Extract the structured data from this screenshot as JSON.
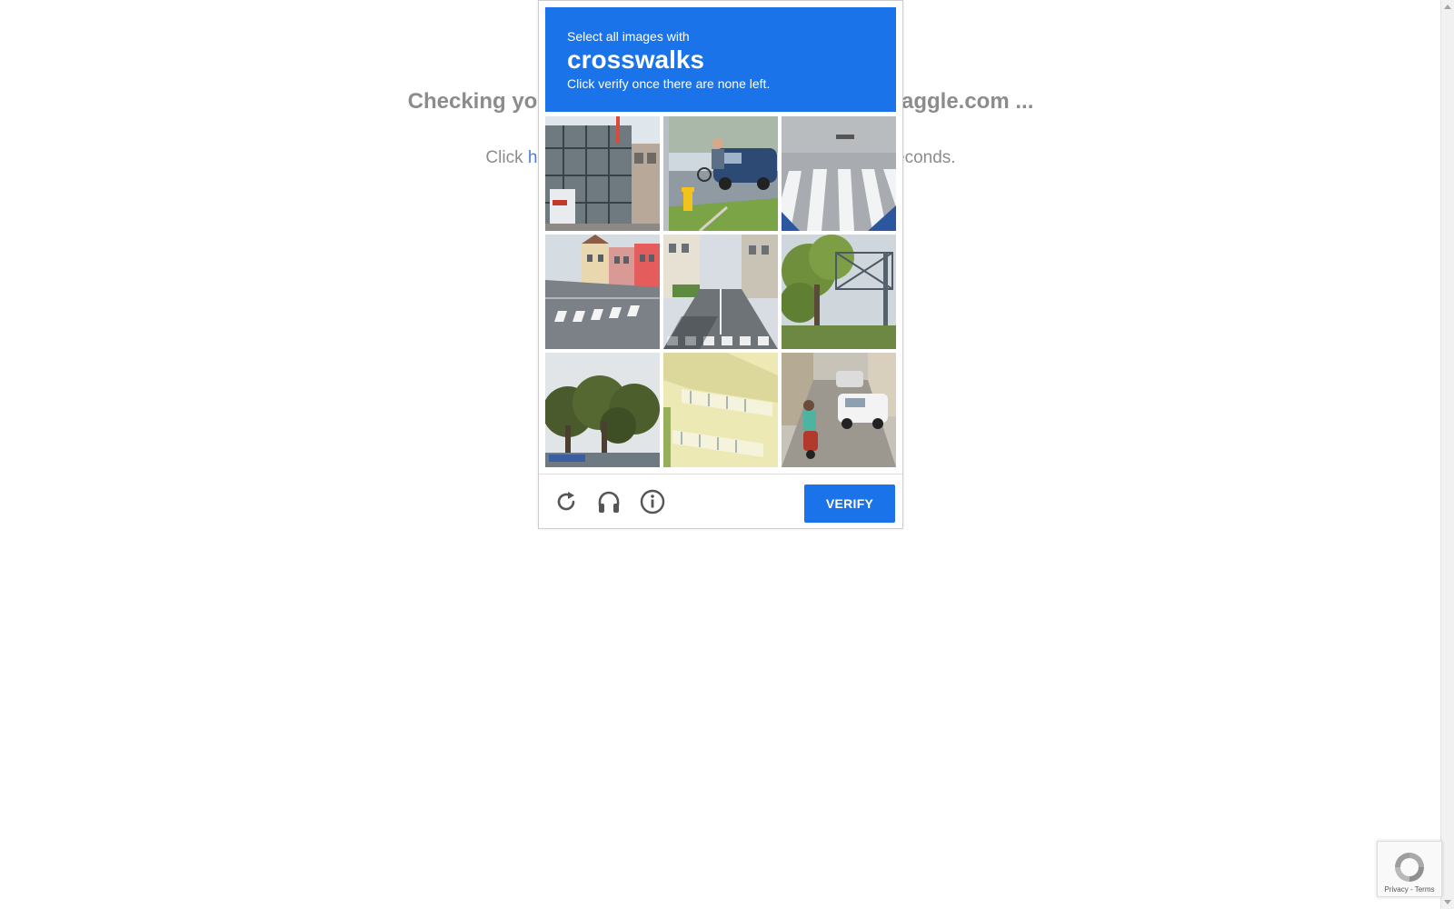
{
  "page": {
    "heading_start": "Checking you",
    "heading_end": "aggle.com ...",
    "subtext_start": "Click ",
    "subtext_link": "he",
    "subtext_end": "econds."
  },
  "captcha": {
    "instruction": "Select all images with",
    "target": "crosswalks",
    "hint": "Click verify once there are none left.",
    "verify_label": "VERIFY",
    "accent_color": "#1a73e8",
    "tiles": [
      {
        "name": "captcha-tile-1",
        "alt": "building under construction"
      },
      {
        "name": "captcha-tile-2",
        "alt": "person with bicycle near car"
      },
      {
        "name": "captcha-tile-3",
        "alt": "crosswalk stripes"
      },
      {
        "name": "captcha-tile-4",
        "alt": "street with crosswalk and houses"
      },
      {
        "name": "captcha-tile-5",
        "alt": "street with crosswalk"
      },
      {
        "name": "captcha-tile-6",
        "alt": "tree and sign gantry"
      },
      {
        "name": "captcha-tile-7",
        "alt": "trees"
      },
      {
        "name": "captcha-tile-8",
        "alt": "balconies"
      },
      {
        "name": "captcha-tile-9",
        "alt": "street with scooter and cars"
      }
    ],
    "footer_icons": [
      "reload-icon",
      "headphones-icon",
      "info-icon"
    ]
  },
  "badge": {
    "privacy": "Privacy",
    "separator": " - ",
    "terms": "Terms"
  }
}
